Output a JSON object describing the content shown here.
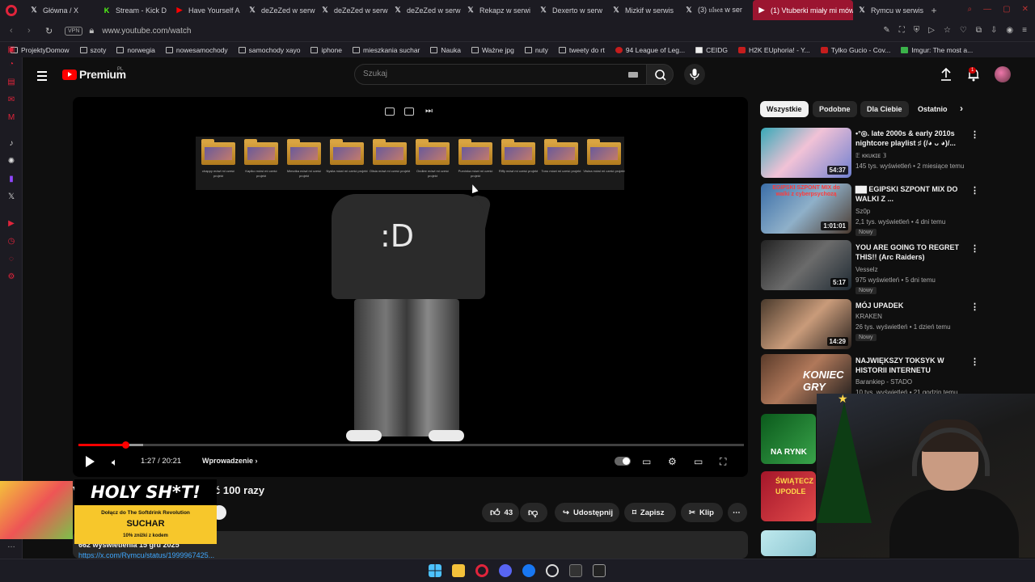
{
  "browser": {
    "tabs": [
      {
        "label": "Główna / X",
        "icon": "x-icon",
        "active": false
      },
      {
        "label": "Stream - Kick D",
        "icon": "kick-icon",
        "active": false
      },
      {
        "label": "Have Yourself A",
        "icon": "youtube-icon",
        "active": false
      },
      {
        "label": "deZeZed w serw",
        "icon": "x-icon",
        "active": false
      },
      {
        "label": "deZeZed w serw",
        "icon": "x-icon",
        "active": false
      },
      {
        "label": "deZeZed w serw",
        "icon": "x-icon",
        "active": false
      },
      {
        "label": "Rekapz w serwi",
        "icon": "x-icon",
        "active": false
      },
      {
        "label": "Dexerto w serw",
        "icon": "x-icon",
        "active": false
      },
      {
        "label": "Mizkif w serwis",
        "icon": "x-icon",
        "active": false
      },
      {
        "label": "(3) 𝔲𝔩𝔰𝔢𝔞 w ser",
        "icon": "x-icon",
        "active": false
      },
      {
        "label": "(1) Vtuberki miały mi mów",
        "icon": "youtube-icon",
        "active": true
      },
      {
        "label": "Rymcu w serwis",
        "icon": "x-icon",
        "active": false
      }
    ],
    "new_tab": "+",
    "vpn": "VPN",
    "url": "www.youtube.com/watch",
    "bookmarks": [
      {
        "label": "ProjektyDomow",
        "icon": "folder-icon"
      },
      {
        "label": "szoty",
        "icon": "folder-icon"
      },
      {
        "label": "norwegia",
        "icon": "folder-icon"
      },
      {
        "label": "nowesamochody",
        "icon": "folder-icon"
      },
      {
        "label": "samochody xayo",
        "icon": "folder-icon"
      },
      {
        "label": "iphone",
        "icon": "folder-icon"
      },
      {
        "label": "mieszkania suchar",
        "icon": "folder-icon"
      },
      {
        "label": "Nauka",
        "icon": "folder-icon"
      },
      {
        "label": "Ważne jpg",
        "icon": "folder-icon"
      },
      {
        "label": "nuty",
        "icon": "folder-icon"
      },
      {
        "label": "tweety do rt",
        "icon": "folder-icon"
      },
      {
        "label": "94 League of Leg...",
        "icon": "league-icon"
      },
      {
        "label": "CEIDG",
        "icon": "flag-icon"
      },
      {
        "label": "H2K EUphoria! - Y...",
        "icon": "youtube-icon"
      },
      {
        "label": "Tylko Gucio - Cov...",
        "icon": "youtube-icon"
      },
      {
        "label": "Imgur: The most a...",
        "icon": "imgur-icon"
      }
    ]
  },
  "youtube": {
    "logo": "Premium",
    "region": "PL",
    "search_placeholder": "Szukaj",
    "notifications": "1",
    "player": {
      "time": "1:27 / 20:21",
      "chapter": "Wprowadzenie",
      "progress": 0.071,
      "face_text": ":D",
      "folders": [
        "chappy mówi mi cześć projekt",
        "Kapiko mówi mi cześć projekt",
        "Mimotka mówi mi cześć projekt",
        "Nyslia mówi mi cześć projekt",
        "Olisia mówi mi cześć projekt",
        "Ondiee mówi mi cześć projekt",
        "Puminka mówi mi cześć projekt",
        "Riffy mówi mi cześć projekt",
        "Tonu mówi mi cześć projekt",
        "Vtsina mówi mi cześć projekt"
      ]
    },
    "video": {
      "title_left": "V",
      "title_right": "ć 100 razy",
      "likes": "43",
      "share": "Udostępnij",
      "save": "Zapisz",
      "clip": "Klip",
      "desc_meta": "662 wyświetlenia  15 gru 2025",
      "desc_link": "https://x.com/Rymcu/status/1999967425..."
    },
    "chips": [
      "Wszystkie",
      "Podobne",
      "Dla Ciebie",
      "Ostatnio"
    ],
    "recommendations": [
      {
        "title": "•°◎. late 2000s & early 2010s nightcore playlist ♯ (/◕ ᴗ ◕)/...",
        "channel": "𝔼 ᴋᴋᴜᴋɪᴇ 𝟛",
        "meta": "145 tys. wyświetleń • 2 miesiące temu",
        "duration": "54:37",
        "new": ""
      },
      {
        "title": "▇▇ EGIPSKI SZPONT MIX DO WALKI Z ...",
        "channel": "Sz0p",
        "meta": "2,1 tys. wyświetleń • 4 dni temu",
        "duration": "1:01:01",
        "new": "Nowy"
      },
      {
        "title": "YOU ARE GOING TO REGRET THIS!! (Arc Raiders)",
        "channel": "Vesselz",
        "meta": "975 wyświetleń • 5 dni temu",
        "duration": "5:17",
        "new": "Nowy"
      },
      {
        "title": "MÓJ UPADEK",
        "channel": "KRAKEN",
        "meta": "26 tys. wyświetleń • 1 dzień temu",
        "duration": "14:29",
        "new": "Nowy"
      },
      {
        "title": "NAJWIĘKSZY TOKSYK W HISTORII INTERNETU",
        "channel": "Barankiep - STADO",
        "meta": "10 tys. wyświetleń • 21 godzin temu",
        "duration": "",
        "new": ""
      }
    ],
    "thumb_overlays": [
      "EGIPSKI SZPONT MIX do walki z cyberpsychozą",
      "KONIEC GRY",
      "NA RYNK",
      "ŚWIĄTECZ UPODLE"
    ]
  },
  "ad": {
    "headline": "HOLY SH*T!",
    "line1": "Dołącz do The Softdrink Revolution",
    "brand": "SUCHAR",
    "line3": "10% zniżki z kodem"
  },
  "colors": {
    "accent": "#ff0000",
    "link": "#3ea6ff",
    "tab_active": "#9b1530",
    "opera": "#e0243b"
  }
}
